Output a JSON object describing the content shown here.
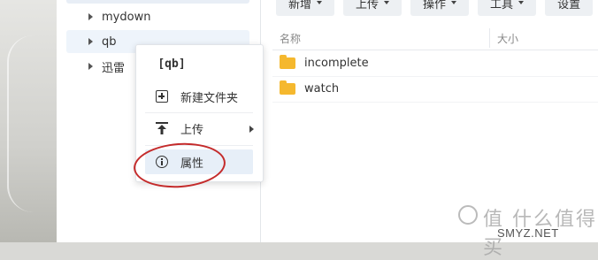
{
  "tree": {
    "items": [
      {
        "label": "mydown"
      },
      {
        "label": "qb"
      },
      {
        "label": "迅雷"
      }
    ]
  },
  "toolbar": {
    "buttons": [
      {
        "label": "新增",
        "has_caret": true
      },
      {
        "label": "上传",
        "has_caret": true
      },
      {
        "label": "操作",
        "has_caret": true
      },
      {
        "label": "工具",
        "has_caret": true
      },
      {
        "label": "设置",
        "has_caret": false
      }
    ]
  },
  "list": {
    "columns": [
      "名称",
      "大小"
    ],
    "rows": [
      {
        "name": "incomplete",
        "type": "folder"
      },
      {
        "name": "watch",
        "type": "folder"
      }
    ]
  },
  "context_menu": {
    "title": "[qb]",
    "items": [
      {
        "label": "新建文件夹",
        "icon": "new-folder-icon",
        "submenu": false
      },
      {
        "label": "上传",
        "icon": "upload-icon",
        "submenu": true
      },
      {
        "label": "属性",
        "icon": "info-icon",
        "submenu": false,
        "highlighted": true
      }
    ]
  },
  "watermark": {
    "brand": "值 什么值得买",
    "site": "SMYZ.NET"
  },
  "colors": {
    "accent_select": "#eef4fb",
    "folder": "#f5b82e",
    "annotation": "#c42b2b"
  }
}
